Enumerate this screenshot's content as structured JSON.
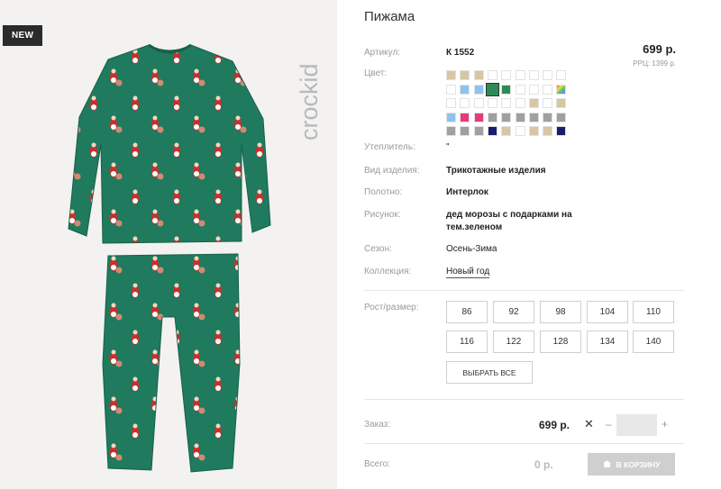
{
  "badge": "NEW",
  "brand_logo_text": "crockid",
  "product": {
    "title": "Пижама",
    "price": "699 р.",
    "rrp": "РРЦ: 1399 р."
  },
  "attributes": {
    "article_label": "Артикул:",
    "article_value": "К 1552",
    "color_label": "Цвет:",
    "insulation_label": "Утеплитель:",
    "insulation_value": "\"",
    "type_label": "Вид изделия:",
    "type_value": "Трикотажные изделия",
    "fabric_label": "Полотно:",
    "fabric_value": "Интерлок",
    "pattern_label": "Рисунок:",
    "pattern_value_line1": "дед морозы с подарками на",
    "pattern_value_line2": "тем.зеленом",
    "season_label": "Сезон:",
    "season_value": "Осень-Зима",
    "collection_label": "Коллекция:",
    "collection_value": "Новый год"
  },
  "swatch_colors": [
    [
      "#d6c6a4",
      "#d6c6a4",
      "#d6c6a4",
      "#ffffff",
      "#ffffff",
      "#ffffff",
      "#ffffff",
      "#ffffff",
      "#ffffff"
    ],
    [
      "#ffffff",
      "#8cc4ee",
      "#8cc4ee",
      "#2e8b57",
      "#2e8b57",
      "#ffffff",
      "#ffffff",
      "#ffffff",
      "rainbow"
    ],
    [
      "#ffffff",
      "#ffffff",
      "#ffffff",
      "#ffffff",
      "#ffffff",
      "#ffffff",
      "#d6c6a4",
      "#ffffff",
      "#d6c6a4"
    ],
    [
      "#8cc4ee",
      "#e63a7a",
      "#e63a7a",
      "#a0a0a0",
      "#a0a0a0",
      "#a0a0a0",
      "#a0a0a0",
      "#a0a0a0",
      "#a0a0a0"
    ],
    [
      "#a0a0a0",
      "#a0a0a0",
      "#a0a0a0",
      "#1b1b70",
      "#d6c6a4",
      "#ffffff",
      "#d6c6a4",
      "#d6c6a4",
      "#1b1b70"
    ]
  ],
  "selected_swatch": "row 2, col 4 (green)",
  "sizes": {
    "label": "Рост/размер:",
    "values": [
      "86",
      "92",
      "98",
      "104",
      "110",
      "116",
      "122",
      "128",
      "134",
      "140"
    ],
    "select_all": "ВЫБРАТЬ ВСЕ"
  },
  "order": {
    "label": "Заказ:",
    "price": "699 р.",
    "times": "✕",
    "minus": "–",
    "plus": "+",
    "quantity": ""
  },
  "total": {
    "label": "Всего:",
    "value": "0 р.",
    "cart_button": "В КОРЗИНУ"
  }
}
